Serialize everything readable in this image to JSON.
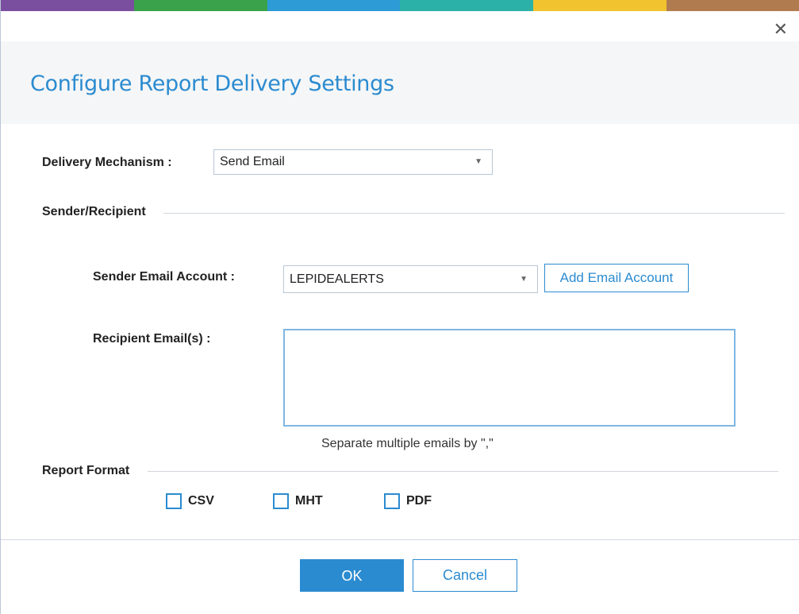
{
  "dialog": {
    "title": "Configure Report Delivery Settings",
    "close_icon": "close-icon",
    "accent_color": "#2b8bd0"
  },
  "delivery": {
    "label": "Delivery Mechanism :",
    "value": "Send Email"
  },
  "sender_recipient": {
    "heading": "Sender/Recipient",
    "sender_label": "Sender Email Account :",
    "sender_value": "LEPIDEALERTS",
    "add_account_label": "Add Email Account",
    "recipient_label": "Recipient Email(s) :",
    "recipient_value": "",
    "hint": "Separate multiple emails by \",\""
  },
  "report_format": {
    "heading": "Report Format",
    "options": [
      {
        "label": "CSV",
        "checked": false
      },
      {
        "label": "MHT",
        "checked": false
      },
      {
        "label": "PDF",
        "checked": false
      }
    ]
  },
  "footer": {
    "ok_label": "OK",
    "cancel_label": "Cancel"
  }
}
